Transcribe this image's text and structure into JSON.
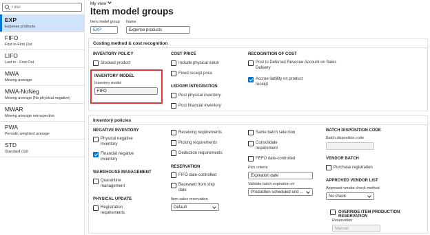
{
  "filter": {
    "placeholder": "Filter"
  },
  "groups": [
    {
      "code": "EXP",
      "name": "Expense products",
      "selected": true
    },
    {
      "code": "FIFO",
      "name": "First in-First Out"
    },
    {
      "code": "LIFO",
      "name": "Last in - First Out"
    },
    {
      "code": "MWA",
      "name": "Moving average"
    },
    {
      "code": "MWA-NoNeg",
      "name": "Moving average (No physical negative)"
    },
    {
      "code": "MWAR",
      "name": "Moving average retrospective"
    },
    {
      "code": "PWA",
      "name": "Periodic weighted average"
    },
    {
      "code": "STD",
      "name": "Standard cost"
    }
  ],
  "header": {
    "view": "My view",
    "title": "Item model groups",
    "item_model_group_label": "Item model group",
    "item_model_group_value": "EXP",
    "name_label": "Name",
    "name_value": "Expense products"
  },
  "costing": {
    "title": "Costing method & cost recognition",
    "inventory_policy": "INVENTORY POLICY",
    "stocked_product": "Stocked product",
    "inventory_model_heading": "INVENTORY MODEL",
    "inventory_model_label": "Inventory model",
    "inventory_model_value": "FIFO",
    "cost_price": "COST PRICE",
    "include_physical_value": "Include physical value",
    "fixed_receipt_price": "Fixed receipt price",
    "ledger_integration": "LEDGER INTEGRATION",
    "post_physical_inventory": "Post physical inventory",
    "post_financial_inventory": "Post financial inventory",
    "recognition_of_cost": "RECOGNITION OF COST",
    "post_deferred_1": "Post to Deferred Revenue Account on Sales",
    "post_deferred_2": "Delivery",
    "accrue_1": "Accrue liability on product",
    "accrue_2": "receipt"
  },
  "policies": {
    "title": "Inventory policies",
    "negative_inventory": "NEGATIVE INVENTORY",
    "physical_negative_1": "Physical negative",
    "physical_negative_2": "inventory",
    "financial_negative_1": "Financial negative",
    "financial_negative_2": "inventory",
    "warehouse_management": "WAREHOUSE MANAGEMENT",
    "quarantine_1": "Quarantine",
    "quarantine_2": "management",
    "physical_update": "PHYSICAL UPDATE",
    "registration_1": "Registration",
    "registration_2": "requirements",
    "receiving_requirements": "Receiving requirements",
    "picking_requirements": "Picking requirements",
    "deduction_requirements": "Deduction requirements",
    "reservation": "RESERVATION",
    "fifo_date_controlled": "FIFO date-controlled",
    "backward_1": "Backward from ship",
    "backward_2": "date",
    "item_sales_reservation_label": "Item sales reservation",
    "item_sales_reservation_value": "Default",
    "same_batch_selection": "Same batch selection",
    "consolidate_1": "Consolidate",
    "consolidate_2": "requirement",
    "fefo_date_controlled": "FEFO date-controlled",
    "pick_criteria_label": "Pick criteria",
    "pick_criteria_value": "Expiration date",
    "validate_batch_label": "Validate batch expiration on",
    "validate_batch_value": "Production scheduled end ...",
    "batch_disposition_code": "BATCH DISPOSITION CODE",
    "batch_disposition_code_label": "Batch disposition code",
    "batch_disposition_code_value": "",
    "vendor_batch": "VENDOR BATCH",
    "purchase_registration": "Purchase registration",
    "approved_vendor_list": "APPROVED VENDOR LIST",
    "approved_vendor_check_label": "Approved vendor check method",
    "approved_vendor_check_value": "No check",
    "override_item_production_reservation": "OVERRIDE ITEM PRODUCTION RESERVATION",
    "reservation_label": "Reservation",
    "reservation_value": "Manual"
  },
  "colors": {
    "accent": "#0078d4",
    "selected_bg": "#cfe4fa",
    "highlight": "#e03b3b"
  }
}
